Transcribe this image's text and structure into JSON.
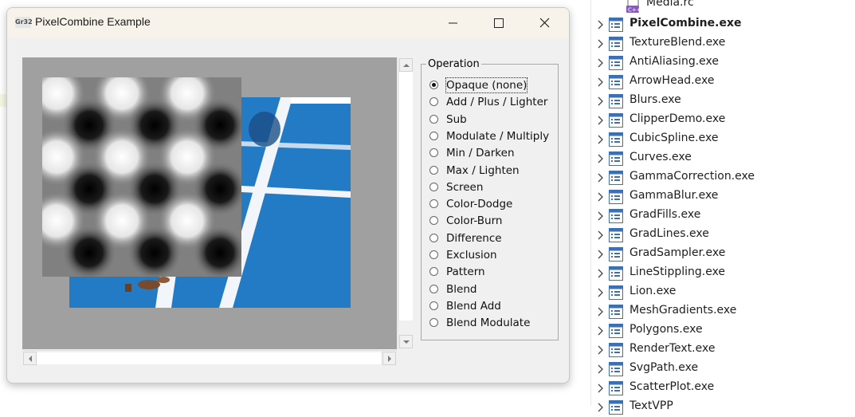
{
  "window": {
    "icon_text": "Gr32",
    "title": "PixelCombine Example"
  },
  "operation_group": {
    "legend": "Operation",
    "selected_index": 0,
    "options": [
      "Opaque (none)",
      "Add / Plus / Lighter",
      "Sub",
      "Modulate / Multiply",
      "Min / Darken",
      "Max / Lighten",
      "Screen",
      "Color-Dodge",
      "Color-Burn",
      "Difference",
      "Exclusion",
      "Pattern",
      "Blend",
      "Blend Add",
      "Blend Modulate"
    ]
  },
  "solution_explorer": {
    "top_file": {
      "name": "Media.rc",
      "icon": "cpp-resource-icon"
    },
    "projects": [
      {
        "name": "PixelCombine.exe",
        "bold": true
      },
      {
        "name": "TextureBlend.exe",
        "bold": false
      },
      {
        "name": "AntiAliasing.exe",
        "bold": false
      },
      {
        "name": "ArrowHead.exe",
        "bold": false
      },
      {
        "name": "Blurs.exe",
        "bold": false
      },
      {
        "name": "ClipperDemo.exe",
        "bold": false
      },
      {
        "name": "CubicSpline.exe",
        "bold": false
      },
      {
        "name": "Curves.exe",
        "bold": false
      },
      {
        "name": "GammaCorrection.exe",
        "bold": false
      },
      {
        "name": "GammaBlur.exe",
        "bold": false
      },
      {
        "name": "GradFills.exe",
        "bold": false
      },
      {
        "name": "GradLines.exe",
        "bold": false
      },
      {
        "name": "GradSampler.exe",
        "bold": false
      },
      {
        "name": "LineStippling.exe",
        "bold": false
      },
      {
        "name": "Lion.exe",
        "bold": false
      },
      {
        "name": "MeshGradients.exe",
        "bold": false
      },
      {
        "name": "Polygons.exe",
        "bold": false
      },
      {
        "name": "RenderText.exe",
        "bold": false
      },
      {
        "name": "SvgPath.exe",
        "bold": false
      },
      {
        "name": "ScatterPlot.exe",
        "bold": false
      },
      {
        "name": "TextVPP",
        "bold": false
      }
    ]
  },
  "colors": {
    "court_blue": "#1f78c4",
    "canvas_gray": "#a0a0a0",
    "titlebar": "#f8f3ea"
  }
}
